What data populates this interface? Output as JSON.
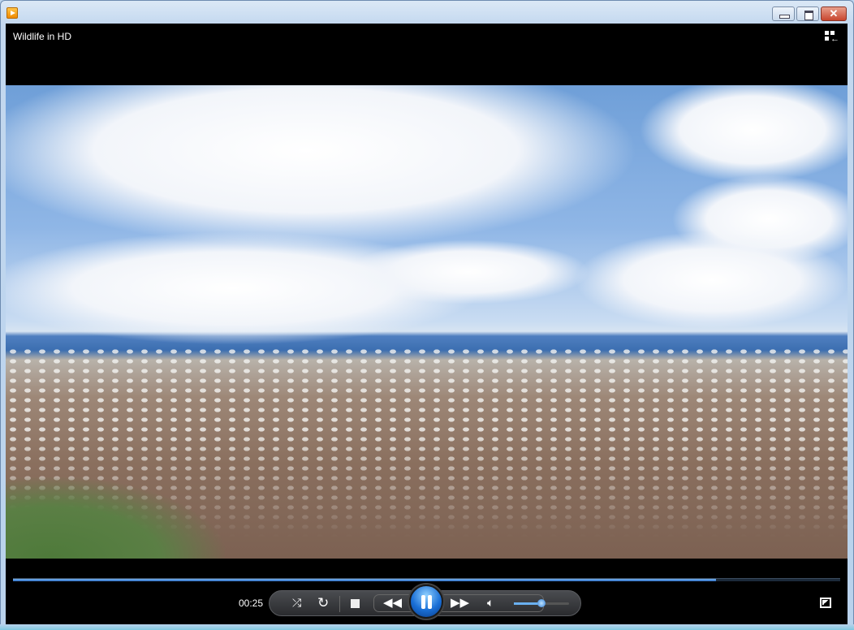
{
  "window": {
    "title": "Wildlife in HD"
  },
  "player": {
    "current_time": "00:25",
    "progress_fraction": 0.85,
    "volume_fraction": 0.5,
    "state": "playing",
    "accent_color": "#2c6fc7"
  }
}
